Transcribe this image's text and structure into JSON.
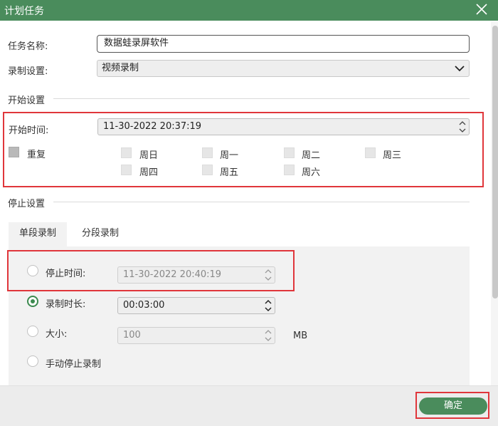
{
  "window": {
    "title": "计划任务"
  },
  "task_name": {
    "label": "任务名称:",
    "value": "数据蛙录屏软件"
  },
  "record_settings": {
    "label": "录制设置:",
    "selected": "视频录制"
  },
  "start_section": {
    "heading": "开始设置",
    "start_time_label": "开始时间:",
    "start_time_value": "11-30-2022 20:37:19",
    "repeat_label": "重复",
    "days": [
      "周日",
      "周一",
      "周二",
      "周三",
      "周四",
      "周五",
      "周六"
    ]
  },
  "stop_section": {
    "heading": "停止设置",
    "tabs": [
      "单段录制",
      "分段录制"
    ],
    "active_tab": "单段录制",
    "stop_time_label": "停止时间:",
    "stop_time_value": "11-30-2022 20:40:19",
    "duration_label": "录制时长:",
    "duration_value": "00:03:00",
    "size_label": "大小:",
    "size_value": "100",
    "size_unit": "MB",
    "manual_label": "手动停止录制",
    "selected_option": "录制时长"
  },
  "footer": {
    "ok_label": "确定"
  },
  "colors": {
    "accent": "#4a8c5c",
    "highlight": "#e0363b"
  },
  "icons": {
    "close": "close-icon",
    "dropdown": "chevron-down-icon",
    "spinner": "spinner-arrows-icon"
  }
}
